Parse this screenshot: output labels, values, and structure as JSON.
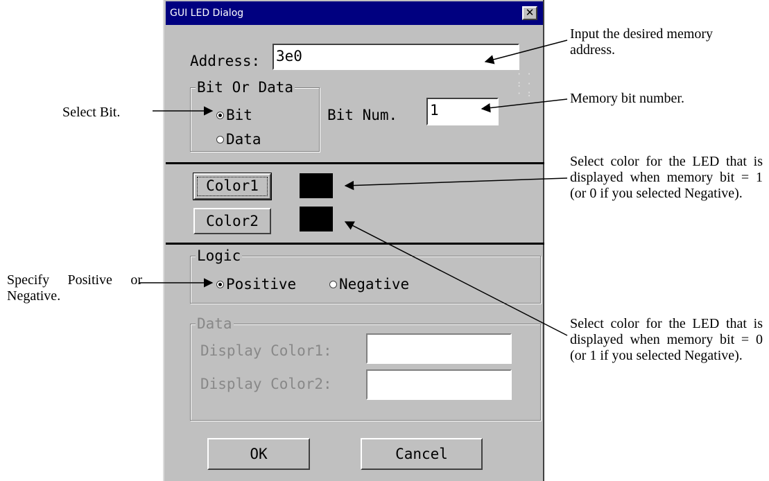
{
  "dialog": {
    "title": "GUI LED Dialog",
    "close_glyph": "✕",
    "address_label": "Address:",
    "address_value": "3e0",
    "bit_or_data": {
      "legend": "Bit Or Data",
      "bit_label": "Bit",
      "data_label": "Data",
      "selected": "Bit",
      "bit_num_label": "Bit Num.",
      "bit_num_value": "1"
    },
    "color1_button": "Color1",
    "color2_button": "Color2",
    "color1_swatch": "#000000",
    "color2_swatch": "#000000",
    "logic": {
      "legend": "Logic",
      "positive_label": "Positive",
      "negative_label": "Negative",
      "selected": "Positive"
    },
    "data_group": {
      "legend": "Data",
      "display_color1_label": "Display Color1:",
      "display_color2_label": "Display Color2:",
      "display_color1_value": "",
      "display_color2_value": ""
    },
    "ok_button": "OK",
    "cancel_button": "Cancel"
  },
  "annotations": {
    "address": "Input the desired memory address.",
    "bit_num": "Memory bit number.",
    "select_bit": "Select Bit.",
    "color1": "Select color for the LED that is displayed when memory bit = 1 (or 0 if you selected Negative).",
    "logic": "Specify Positive or Negative.",
    "color2": "Select color for the LED that is displayed when memory bit = 0 (or 1 if you selected Negative)."
  },
  "colors": {
    "titlebar": "#000080",
    "dialog_face": "#c0c0c0",
    "disabled_text": "#888888"
  }
}
